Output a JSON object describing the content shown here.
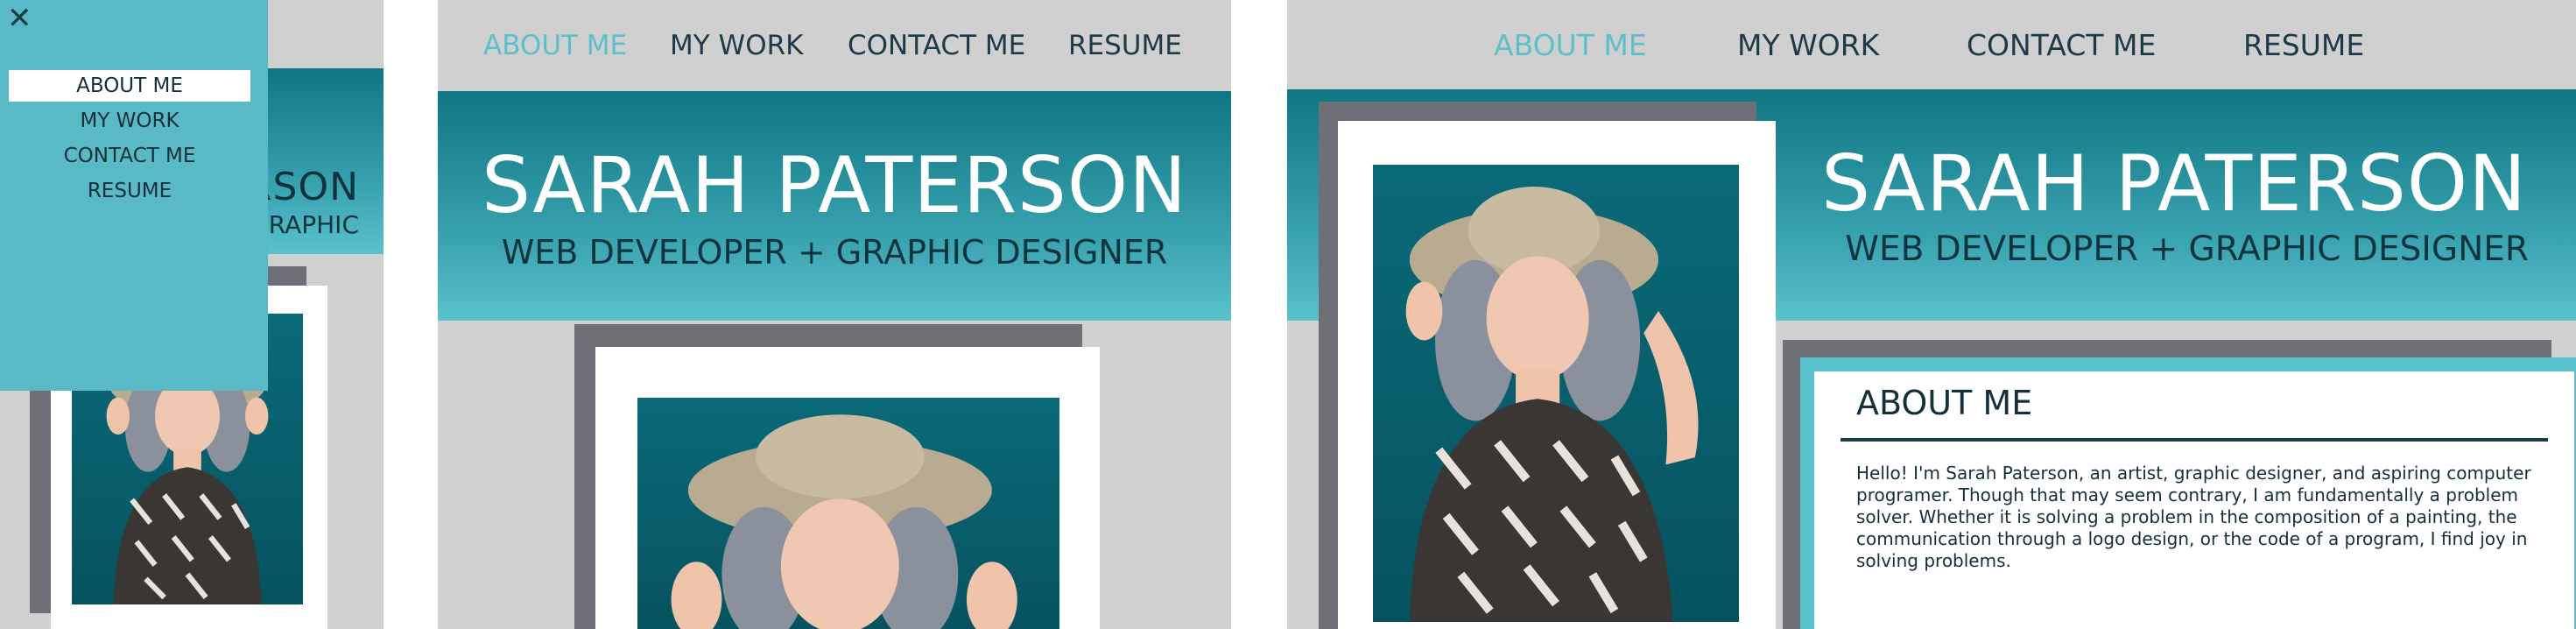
{
  "site": {
    "name": "SARAH PATERSON",
    "tagline": "WEB DEVELOPER + GRAPHIC DESIGNER",
    "partial_name": "RSON",
    "partial_tagline": "RAPHIC"
  },
  "nav": {
    "items": [
      "ABOUT ME",
      "MY WORK",
      "CONTACT ME",
      "RESUME"
    ],
    "active": "ABOUT ME"
  },
  "mobile_menu": {
    "close_icon": "close-icon",
    "close_glyph": "✕"
  },
  "about": {
    "title": "ABOUT ME",
    "body": "Hello! I'm Sarah Paterson, an artist, graphic designer, and aspiring computer programer. Though that may seem contrary, I am fundamentally a problem solver. Whether it is solving a problem in the composition of a painting, the communication through a logo design, or the code of a program, I find joy in solving problems."
  },
  "photo": {
    "subject": "portrait-photo"
  },
  "colors": {
    "accent": "#5cc0cb",
    "banner_top": "#0f7683",
    "banner_bottom": "#5ac2cc",
    "background": "#d0d0d0",
    "frame_gray": "#6f6f77",
    "text_dark": "#1d3b47"
  }
}
